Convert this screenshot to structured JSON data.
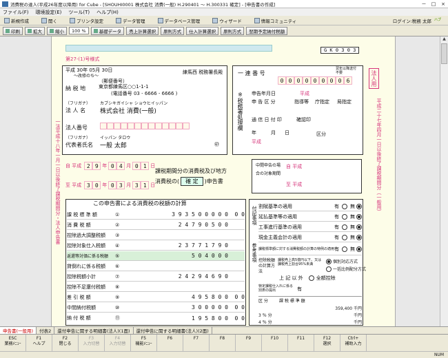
{
  "window": {
    "title": "消費税の達人(平成26年度以降用) for Cube - [SHOUHI0001 株式会社 消費(一般) H.290401 ～ H.300331 確定] - [申告書の作成]",
    "min": "－",
    "max": "□",
    "close": "×"
  },
  "menu": [
    "ファイル(F)",
    "環境設定(E)",
    "ツール(T)",
    "ヘルプ(H)"
  ],
  "toolbar1": {
    "items": [
      "新規作成",
      "開く",
      "プリンタ設定",
      "データ管理",
      "データベース管理",
      "ウィザード",
      "情報コミュニティ"
    ],
    "login": "ログイン:税務 太郎",
    "logo": "ハブ"
  },
  "toolbar2": {
    "print": "印刷",
    "zoom_in": "拡大",
    "zoom_out": "縮小",
    "zoom": "100 %",
    "base": "基礎データ",
    "buttons": [
      "売上計算選択",
      "原則方式",
      "仕入計算選択",
      "原則方式",
      "翌期予定納付税額"
    ]
  },
  "form": {
    "form_no": "第27-(1)号様式",
    "gk": "G K 0 3 0 3",
    "date": "平成 30年 05月 30日",
    "chief": "練馬西 税務署長殿",
    "zip_label": "（郵便番号）",
    "tax_label": "納 税 地",
    "address": "東京都練馬区○○1-1-1",
    "phone": "(電話番号 03 - 6666 - 6666 )",
    "furigana_label": "（フリガナ）",
    "furigana": "カブシキガイシャ ショウヒイッパン",
    "corp_label": "法 人 名",
    "corp_name": "株式会社 消費(一般)",
    "corpnum_label": "法人番号",
    "rep_furi": "イッパン タロウ",
    "rep_label": "代表者氏名",
    "rep_name": "一般 太郎",
    "seal": "㊞",
    "side_mark": "法人用",
    "serial_label": "一 連 番 号",
    "mgmt": "翌年以降送付不要",
    "serial": [
      "0",
      "0",
      "0",
      "0",
      "0",
      "0",
      "0",
      "0",
      "6"
    ],
    "filing_date": "申告年月日",
    "heisei": "平成",
    "filing_type": "申 告 区 分",
    "guidance": "指導等",
    "office": "庁指定",
    "station": "局指定",
    "receipt": "通 信 日 付 印",
    "confirm": "確認印",
    "year": "年",
    "month": "月",
    "day": "日",
    "section_label": "区分",
    "side_section": [
      "※税務署処理欄"
    ],
    "period_from_label": "自 平成",
    "period_from": [
      "2",
      "9",
      "0",
      "4",
      "0",
      "1"
    ],
    "period_to_label": "至 平成",
    "period_to": [
      "3",
      "0",
      "0",
      "3",
      "3",
      "1"
    ],
    "period_units": [
      "年",
      "月",
      "日"
    ],
    "title1": "課税期間分の消費税及び地方",
    "title2": "消費税の(",
    "title_type": "確 定",
    "title3": ")申告書",
    "mid_label": "中間申告の場合の対象期間",
    "mid_from": "自 平成",
    "mid_to": "至 平成",
    "left_vertical": "一法平成十八年一月一日以後終了課税期間分・法人申告書",
    "right_vertical": "平成二十七年四月一日以後終了課税期間分（一般用）",
    "section_title": "この申告書による消費税の税額の計算",
    "rows": [
      {
        "label": "課 税 標 準 額",
        "no": "①",
        "val": "3 9 3 5 0 0 0 0 0",
        "unit": "0 0"
      },
      {
        "label": "消 費 税 額",
        "no": "②",
        "val": "2 4 7 9 0 5 0 0",
        "unit": ""
      },
      {
        "label": "控除過大調整税額",
        "no": "③",
        "val": "",
        "unit": ""
      },
      {
        "label": "控除対象仕入税額",
        "no": "④",
        "val": "2 3 7 7 1 7 9 0",
        "unit": ""
      },
      {
        "label": "返還等対価に係る税額",
        "no": "⑤",
        "val": "5 0 4 0 0 0",
        "unit": ""
      },
      {
        "label": "貸倒れに係る税額",
        "no": "⑥",
        "val": "",
        "unit": ""
      },
      {
        "label": "控除税額小計",
        "no": "⑦",
        "val": "2 4 2 9 4 6 9 0",
        "unit": ""
      },
      {
        "label": "控除不足還付税額",
        "no": "⑧",
        "val": "",
        "unit": ""
      },
      {
        "label": "差 引 税 額",
        "no": "⑨",
        "val": "4 9 5 8 0 0",
        "unit": "0 0"
      },
      {
        "label": "中間納付税額",
        "no": "⑩",
        "val": "3 0 0 0 0 0",
        "unit": "0 0"
      },
      {
        "label": "納 付 税 額",
        "no": "⑪",
        "val": "1 9 5 8 0 0",
        "unit": "0 0"
      }
    ],
    "right_rows": [
      {
        "label": "割賦基準の適用",
        "yes": "有",
        "no": "無"
      },
      {
        "label": "延払基準等の適用",
        "yes": "有",
        "no": "無"
      },
      {
        "label": "工事進行基準の適用",
        "yes": "有",
        "no": "無"
      },
      {
        "label": "現金主義会計の適用",
        "yes": "有",
        "no": "無"
      },
      {
        "label": "課税標準額に対する消費税額の計算の特例の適用",
        "yes": "有",
        "no": "無"
      }
    ],
    "side_labels": [
      "付記事項",
      "参考事項"
    ],
    "deduct_label": "控除税額の計算方法",
    "deduct1": "課税売上高5億円以下、又は課税売上割合95%未満",
    "deduct2": "個別対応方式",
    "deduct3": "一括比例配分方式",
    "deduct4": "上 記 以 外",
    "deduct5": "全額控除",
    "special_label": "特定課税仕入れに係る別表の提出",
    "base_label": "課 税 標 準 額",
    "base_hdr": "区 分",
    "base_val": "359,400 千円",
    "rates": [
      "3 ％ 分",
      "4 ％ 分"
    ],
    "rate_unit": "千円"
  },
  "status": {
    "tabs": [
      "申告書(一般用)",
      "付表2",
      "還付申告に関する明細書(法人)(1面)",
      "還付申告に関する明細書(法人)(2面)"
    ]
  },
  "fkeys": [
    {
      "key": "ESC",
      "label": "業務ﾒﾆｭｰ"
    },
    {
      "key": "F1",
      "label": "ヘルプ"
    },
    {
      "key": "F2",
      "label": "閉じる"
    },
    {
      "key": "F3",
      "label": "入力切替"
    },
    {
      "key": "F4",
      "label": "入力切替"
    },
    {
      "key": "F5",
      "label": "機能ﾒﾆｭｰ"
    },
    {
      "key": "F6",
      "label": ""
    },
    {
      "key": "F7",
      "label": ""
    },
    {
      "key": "F8",
      "label": ""
    },
    {
      "key": "F9",
      "label": ""
    },
    {
      "key": "F10",
      "label": ""
    },
    {
      "key": "F11",
      "label": ""
    },
    {
      "key": "F12",
      "label": "選択"
    },
    {
      "key": "Ctrl+",
      "label": "補助入力"
    }
  ],
  "numlock": "NUM"
}
